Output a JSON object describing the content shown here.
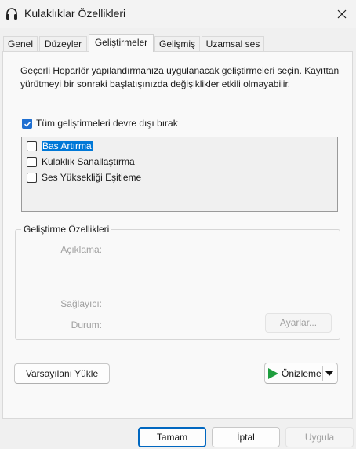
{
  "window": {
    "title": "Kulaklıklar Özellikleri"
  },
  "tabs": [
    {
      "label": "Genel"
    },
    {
      "label": "Düzeyler"
    },
    {
      "label": "Geliştirmeler",
      "active": true
    },
    {
      "label": "Gelişmiş"
    },
    {
      "label": "Uzamsal ses"
    }
  ],
  "description": "Geçerli Hoparlör yapılandırmanıza uygulanacak geliştirmeleri seçin. Kayıttan yürütmeyi bir sonraki başlatışınızda değişiklikler etkili olmayabilir.",
  "disable_all": {
    "label": "Tüm geliştirmeleri devre dışı bırak",
    "checked": true
  },
  "enhancements": [
    {
      "label": "Bas Artırma",
      "checked": false,
      "selected": true
    },
    {
      "label": "Kulaklık Sanallaştırma",
      "checked": false,
      "selected": false
    },
    {
      "label": "Ses Yüksekliği Eşitleme",
      "checked": false,
      "selected": false
    }
  ],
  "properties": {
    "legend": "Geliştirme Özellikleri",
    "description_label": "Açıklama:",
    "provider_label": "Sağlayıcı:",
    "status_label": "Durum:",
    "settings_button": "Ayarlar..."
  },
  "buttons": {
    "restore_defaults": "Varsayılanı Yükle",
    "preview": "Önizleme",
    "ok": "Tamam",
    "cancel": "İptal",
    "apply": "Uygula"
  },
  "colors": {
    "accent": "#0067c0",
    "checkbox_checked": "#1f6fd1",
    "selection": "#0078d7",
    "play_icon": "#1e9e3e"
  },
  "icons": {
    "title": "headphones-icon",
    "close": "close-icon",
    "preview_play": "play-icon",
    "preview_dropdown": "caret-down-icon"
  }
}
